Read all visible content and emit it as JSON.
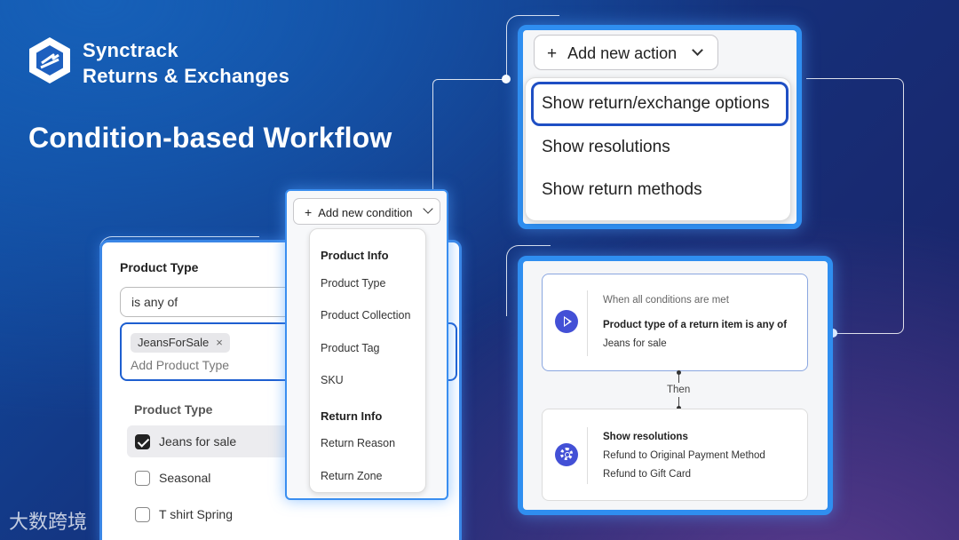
{
  "brand": {
    "name": "Synctrack",
    "subtitle": "Returns & Exchanges"
  },
  "headline": "Condition-based Workflow",
  "condition_editor": {
    "field_label": "Product Type",
    "operator_value": "is any of",
    "tag_chip": "JeansForSale",
    "tag_remove_icon": "×",
    "add_placeholder": "Add Product Type",
    "dropdown_title": "Product Type",
    "options": [
      {
        "label": "Jeans for sale",
        "checked": true
      },
      {
        "label": "Seasonal",
        "checked": false
      },
      {
        "label": "T shirt Spring",
        "checked": false
      }
    ]
  },
  "add_condition": {
    "button_label": "Add new condition",
    "plus": "+",
    "groups": [
      {
        "heading": "Product Info",
        "items": [
          "Product Type",
          "Product Collection",
          "Product Tag",
          "SKU"
        ]
      },
      {
        "heading": "Return Info",
        "items": [
          "Return Reason",
          "Return Zone"
        ]
      }
    ]
  },
  "add_action": {
    "button_label": "Add new action",
    "plus": "+",
    "options": [
      "Show return/exchange options",
      "Show resolutions",
      "Show return methods"
    ],
    "highlighted_index": 0
  },
  "workflow": {
    "trigger": {
      "icon": "play-icon",
      "caption": "When all conditions are met",
      "condition": "Product type of a return item is any of",
      "value": "Jeans for sale"
    },
    "connector_label": "Then",
    "action": {
      "icon": "gear-icon",
      "title": "Show resolutions",
      "items": [
        "Refund to Original Payment Method",
        "Refund to Gift Card"
      ]
    }
  },
  "watermark": "大数跨境",
  "colors": {
    "accent": "#2f8ef0",
    "highlight_border": "#1f4fc4",
    "icon_circle": "#4350d6"
  }
}
